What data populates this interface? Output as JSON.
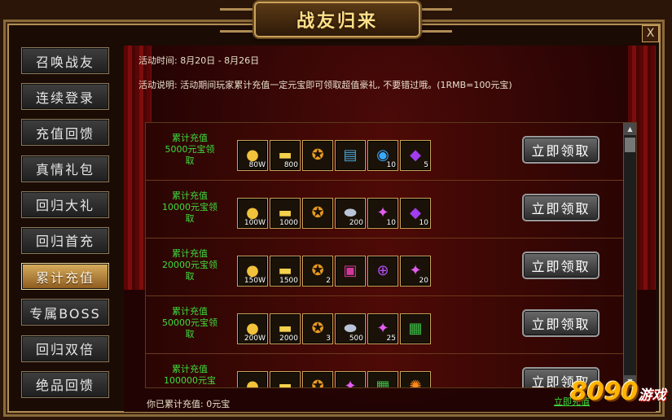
{
  "window": {
    "title": "战友归来",
    "close_label": "X"
  },
  "sidebar": {
    "items": [
      {
        "label": "召唤战友",
        "active": false
      },
      {
        "label": "连续登录",
        "active": false
      },
      {
        "label": "充值回馈",
        "active": false
      },
      {
        "label": "真情礼包",
        "active": false
      },
      {
        "label": "回归大礼",
        "active": false
      },
      {
        "label": "回归首充",
        "active": false
      },
      {
        "label": "累计充值",
        "active": true
      },
      {
        "label": "专属BOSS",
        "active": false
      },
      {
        "label": "回归双倍",
        "active": false
      },
      {
        "label": "绝品回馈",
        "active": false
      }
    ]
  },
  "main": {
    "activity_time": "活动时间: 8月20日 - 8月26日",
    "activity_desc": "活动说明: 活动期间玩家累计充值一定元宝即可领取超值豪礼, 不要错过哦。(1RMB=100元宝)",
    "rewards": [
      {
        "label": "累计充值\n5000元宝领\n取",
        "claim_label": "立即领取",
        "items": [
          {
            "icon": "gold-coins-icon",
            "qty": "80W"
          },
          {
            "icon": "gold-ingot-icon",
            "qty": "800"
          },
          {
            "icon": "golden-medal-icon",
            "qty": ""
          },
          {
            "icon": "skill-book-icon",
            "qty": ""
          },
          {
            "icon": "blue-orb-icon",
            "qty": "10"
          },
          {
            "icon": "purple-gem-icon",
            "qty": "5"
          }
        ]
      },
      {
        "label": "累计充值\n10000元宝领\n取",
        "claim_label": "立即领取",
        "items": [
          {
            "icon": "gold-coins-icon",
            "qty": "100W"
          },
          {
            "icon": "gold-ingot-icon",
            "qty": "1000"
          },
          {
            "icon": "golden-medal-icon",
            "qty": ""
          },
          {
            "icon": "silver-stone-icon",
            "qty": "200"
          },
          {
            "icon": "pink-crystal-icon",
            "qty": "10"
          },
          {
            "icon": "purple-gem-icon",
            "qty": "10"
          }
        ]
      },
      {
        "label": "累计充值\n20000元宝领\n取",
        "claim_label": "立即领取",
        "items": [
          {
            "icon": "gold-coins-icon",
            "qty": "150W"
          },
          {
            "icon": "gold-ingot-icon",
            "qty": "1500"
          },
          {
            "icon": "golden-medal-icon",
            "qty": "2"
          },
          {
            "icon": "armor-icon",
            "qty": ""
          },
          {
            "icon": "purple-seal-icon",
            "qty": ""
          },
          {
            "icon": "pink-crystal-icon",
            "qty": "20"
          }
        ]
      },
      {
        "label": "累计充值\n50000元宝领\n取",
        "claim_label": "立即领取",
        "items": [
          {
            "icon": "gold-coins-icon",
            "qty": "200W"
          },
          {
            "icon": "gold-ingot-icon",
            "qty": "2000"
          },
          {
            "icon": "golden-medal-icon",
            "qty": "3"
          },
          {
            "icon": "silver-stone-icon",
            "qty": "500"
          },
          {
            "icon": "pink-crystal-icon",
            "qty": "25"
          },
          {
            "icon": "treasure-chest-icon",
            "qty": ""
          }
        ]
      },
      {
        "label": "累计充值\n100000元宝",
        "claim_label": "立即领取",
        "items": [
          {
            "icon": "gold-coins-icon",
            "qty": ""
          },
          {
            "icon": "gold-ingot-icon",
            "qty": ""
          },
          {
            "icon": "golden-medal-icon",
            "qty": ""
          },
          {
            "icon": "pink-crystal-icon",
            "qty": ""
          },
          {
            "icon": "treasure-chest-icon",
            "qty": ""
          },
          {
            "icon": "orange-orb-icon",
            "qty": ""
          }
        ]
      }
    ],
    "total_recharge": "你已累计充值: 0元宝",
    "recharge_link": "立即充值"
  },
  "branding": {
    "logo_num": "8090",
    "logo_text": "游戏"
  },
  "colors": {
    "accent_gold": "#c9a35a",
    "reward_label_green": "#3fdc3f",
    "panel_red": "#4e0a06"
  }
}
